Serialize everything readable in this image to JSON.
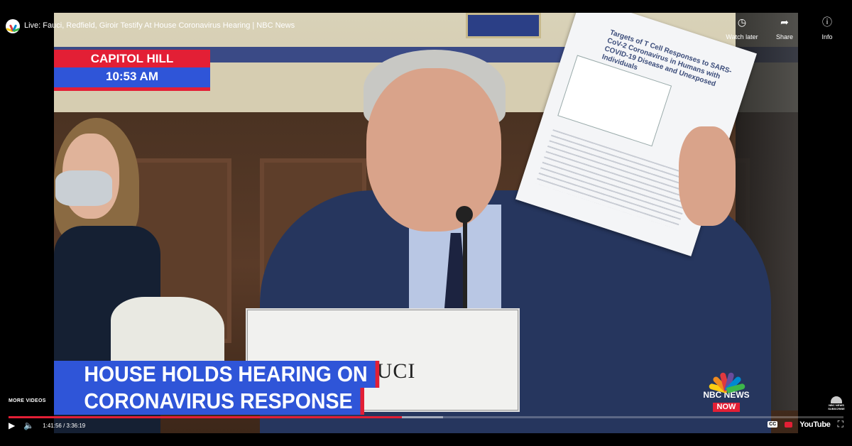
{
  "window": {
    "title": "Live: Fauci, Redfield, Giroir Testify At House Coronavirus Hearing | NBC News",
    "channel_logo_icon": "nbc-peacock-icon"
  },
  "top_actions": [
    {
      "label": "Watch later",
      "icon": "clock-icon",
      "glyph": "◷"
    },
    {
      "label": "Share",
      "icon": "share-arrow-icon",
      "glyph": "➦"
    },
    {
      "label": "Info",
      "icon": "info-icon",
      "glyph": "ⓘ"
    }
  ],
  "broadcast": {
    "location": "CAPITOL HILL",
    "time": "10:53 AM",
    "headline_line1": "HOUSE HOLDS HEARING ON",
    "headline_line2": "CORONAVIRUS RESPONSE",
    "nameplate": "AUCI",
    "document_title": "Targets of T Cell Responses to SARS-CoV-2 Coronavirus in Humans with COVID-19 Disease and Unexposed Individuals",
    "network_bug_line1": "NBC NEWS",
    "network_bug_line2": "NOW",
    "colors": {
      "red": "#e31f35",
      "blue": "#2f55d8"
    }
  },
  "player": {
    "more_videos": "MORE VIDEOS",
    "current_time": "1:41:56",
    "duration": "3:36:19",
    "time_display": "1:41:56 / 3:36:19",
    "played_fraction": 0.471,
    "loaded_fraction": 0.52,
    "brand": "YouTube",
    "cc_label": "CC",
    "watermark_text": "NBC NEWS SUBSCRIBE",
    "icons": {
      "play": "play-icon",
      "volume": "volume-icon",
      "subtitles": "subtitles-icon",
      "fullscreen": "fullscreen-icon"
    }
  }
}
